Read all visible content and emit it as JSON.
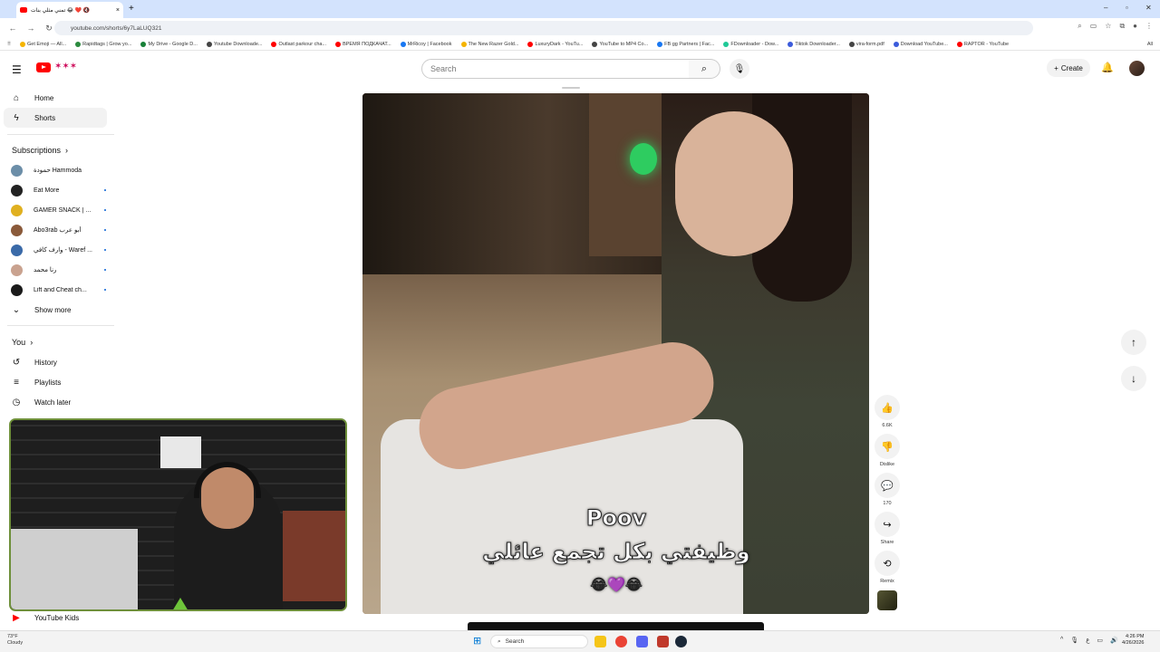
{
  "browser": {
    "tab_title": "تمني مثلي بنات 😂 ❤️ 🔇",
    "url": "youtube.com/shorts/6y7LaLUQ321",
    "bookmarks": [
      {
        "label": "Get Emoji — All...",
        "color": "#f5b400"
      },
      {
        "label": "Rapidtags | Grow yo...",
        "color": "#2b8a3e"
      },
      {
        "label": "My Drive - Google D...",
        "color": "#188038"
      },
      {
        "label": "Youtube Downloade...",
        "color": "#444444"
      },
      {
        "label": "Outlast parkour cha...",
        "color": "#ff0000"
      },
      {
        "label": "ВРЕМЯ ПОДКАЧАТ...",
        "color": "#ff0000"
      },
      {
        "label": "MrRicoy | Facebook",
        "color": "#1877f2"
      },
      {
        "label": "The New Razer Gold...",
        "color": "#f5b400"
      },
      {
        "label": "LuxuryDark - YouTu...",
        "color": "#ff0000"
      },
      {
        "label": "YouTube to MP4 Co...",
        "color": "#444444"
      },
      {
        "label": "FB gg Partners | Fac...",
        "color": "#1877f2"
      },
      {
        "label": "FDownloader - Dow...",
        "color": "#20c997"
      },
      {
        "label": "Tiktok Downloader...",
        "color": "#3b5bdb"
      },
      {
        "label": "vira-form.pdf",
        "color": "#444444"
      },
      {
        "label": "Download YouTube...",
        "color": "#3b5bdb"
      },
      {
        "label": "RAPTOR - YouTube",
        "color": "#ff0000"
      }
    ],
    "all_bookmarks": "All"
  },
  "header": {
    "search_placeholder": "Search",
    "create_label": "Create"
  },
  "sidebar": {
    "main": [
      {
        "label": "Home",
        "icon": "home-icon"
      },
      {
        "label": "Shorts",
        "icon": "shorts-icon"
      }
    ],
    "subscriptions_title": "Subscriptions",
    "channels": [
      {
        "name": "حمودة Hammoda",
        "color": "#6c8ea8",
        "live": false
      },
      {
        "name": "Eat More",
        "color": "#222222",
        "live": true
      },
      {
        "name": "GAMER SNACK | ...",
        "color": "#e0b020",
        "live": true
      },
      {
        "name": "Abo3rab أبو عرب",
        "color": "#8a5a3a",
        "live": true
      },
      {
        "name": "وارف كافي - Waref ...",
        "color": "#3a6aa8",
        "live": true
      },
      {
        "name": "رنا محمد",
        "color": "#c9a28f",
        "live": true
      },
      {
        "name": "Lift and Cheat ch...",
        "color": "#1a1a1a",
        "live": true
      }
    ],
    "show_more": "Show more",
    "you_title": "You",
    "you_items": [
      {
        "label": "History",
        "icon": "history-icon"
      },
      {
        "label": "Playlists",
        "icon": "playlists-icon"
      },
      {
        "label": "Watch later",
        "icon": "watch-later-icon"
      }
    ],
    "youtube_kids": "YouTube Kids"
  },
  "video": {
    "caption_title": "Poov",
    "caption_text": "وظيفتي بكل تجمع عائلي",
    "caption_emoji": "😂💜😂"
  },
  "actions": [
    {
      "label": "6.6K",
      "icon": "like-icon"
    },
    {
      "label": "Dislike",
      "icon": "dislike-icon"
    },
    {
      "label": "170",
      "icon": "comment-icon"
    },
    {
      "label": "Share",
      "icon": "share-icon"
    },
    {
      "label": "Remix",
      "icon": "remix-icon"
    }
  ],
  "taskbar": {
    "weather_temp": "73°F",
    "weather_desc": "Cloudy",
    "search_label": "Search",
    "time": "4:26 PM",
    "date": "4/26/2026"
  }
}
